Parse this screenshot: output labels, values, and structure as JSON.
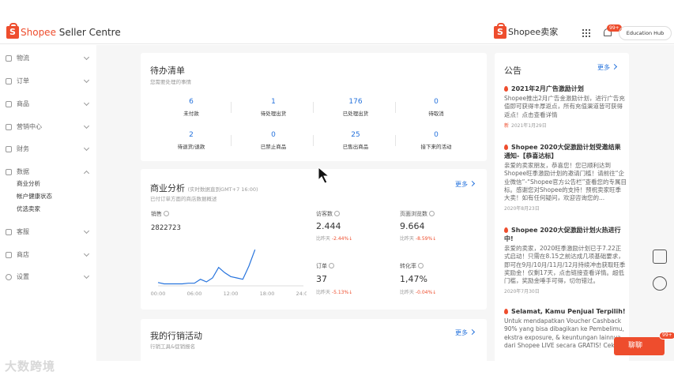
{
  "header": {
    "brand": "Shopee",
    "brand_suffix": "Seller Centre",
    "brand2": "Shopee卖家",
    "notif_badge": "99+",
    "edu_hub": "Education Hub",
    "accent": "#ee4d2d"
  },
  "sidebar": {
    "items": [
      {
        "label": "物流",
        "icon": "truck-icon"
      },
      {
        "label": "订单",
        "icon": "order-icon"
      },
      {
        "label": "商品",
        "icon": "product-icon"
      },
      {
        "label": "营销中心",
        "icon": "marketing-icon"
      },
      {
        "label": "财务",
        "icon": "finance-icon"
      },
      {
        "label": "数据",
        "icon": "data-icon"
      },
      {
        "label": "客服",
        "icon": "support-icon"
      },
      {
        "label": "商店",
        "icon": "shop-icon"
      },
      {
        "label": "设置",
        "icon": "settings-icon"
      }
    ],
    "data_subitems": [
      "商业分析",
      "帐户健康状态",
      "优选卖家"
    ]
  },
  "todo": {
    "title": "待办清单",
    "subtitle": "您需要处理的事情",
    "stats": [
      {
        "value": "6",
        "label": "未付款"
      },
      {
        "value": "1",
        "label": "待处理出货"
      },
      {
        "value": "176",
        "label": "已处理出货"
      },
      {
        "value": "0",
        "label": "待取消"
      },
      {
        "value": "2",
        "label": "待退货/退款"
      },
      {
        "value": "0",
        "label": "已禁止商品"
      },
      {
        "value": "25",
        "label": "已售出商品"
      },
      {
        "value": "0",
        "label": "接下来的活动"
      }
    ]
  },
  "analytics": {
    "title": "商业分析",
    "title_note": "(实时数据直到GMT+7 16:00)",
    "subtitle": "已付订单方面的商店数据概述",
    "more": "更多",
    "sales_label": "销售",
    "sales_value": "2822723",
    "metrics": [
      {
        "label": "访客数",
        "value": "2.444",
        "compare": "比昨天",
        "change": "-2.44%"
      },
      {
        "label": "页面浏览数",
        "value": "9.664",
        "compare": "比昨天",
        "change": "-8.59%"
      },
      {
        "label": "订单",
        "value": "37",
        "compare": "比昨天",
        "change": "-5.13%"
      },
      {
        "label": "转化率",
        "value": "1,47%",
        "compare": "比昨天",
        "change": "-0.04%"
      }
    ]
  },
  "chart_data": {
    "type": "line",
    "x": [
      "00:00",
      "01:00",
      "02:00",
      "03:00",
      "04:00",
      "05:00",
      "06:00",
      "07:00",
      "08:00",
      "09:00",
      "10:00",
      "11:00",
      "12:00",
      "13:00",
      "14:00",
      "15:00",
      "16:00"
    ],
    "values": [
      5,
      3,
      3,
      3,
      3,
      4,
      4,
      10,
      6,
      12,
      28,
      20,
      14,
      12,
      10,
      30,
      55
    ],
    "tick_labels": [
      "00:00",
      "06:00",
      "12:00",
      "18:00",
      "24:00"
    ],
    "ylim": [
      0,
      60
    ],
    "grid": false,
    "color": "#2673dd"
  },
  "marketing": {
    "title": "我的行销活动",
    "subtitle": "行销工具&促销报名",
    "more": "更多"
  },
  "announcements": {
    "title": "公告",
    "more": "更多",
    "items": [
      {
        "title": "2021年2月广告激励计划",
        "body": "Shopee推出2月广告金激励计划，进行广告充值即可获得丰厚返点，所有充值渠道皆可获得返点！点击查看详情",
        "date": "2021年1月29日",
        "new": "新"
      },
      {
        "title": "Shopee 2020大促激励计划受邀结果通知-【恭喜达标】",
        "body": "亲爱的卖家朋友，恭喜您！您已顺利达到Shopee旺季激励计划的邀请门槛！请前往“企业微信”-“Shopee官方公告栏”查看您的专属目标。感谢您对Shopee的支持！预祝卖家旺季大卖！如有任何疑问，欢迎咨询您的...",
        "date": "2020年8月23日"
      },
      {
        "title": "Shopee 2020大促激励计划火热进行中!",
        "body": "亲爱的卖家，2020旺季激励计划已于7.22正式启动！只需在8.15之前达成几项基础要求，即可在9月/10月/11月/12月持续冲击获取旺季奖励金！仅剩17天，点击链接查看详情。超低门槛，奖励金唾手可得，切勿错过。",
        "date": "2020年7月30日"
      },
      {
        "title": "Selamat, Kamu Penjual Terpilih!",
        "body": "Untuk mendapatkan Voucher Cashback 90% yang bisa dibagikan ke Pembelimu, ekstra exposure, & keuntungan lainnya dari Shopee LIVE secara GRATIS! Cek"
      }
    ]
  },
  "chat": {
    "label": "聊聊",
    "badge": "99+"
  },
  "watermark": "大数跨境"
}
